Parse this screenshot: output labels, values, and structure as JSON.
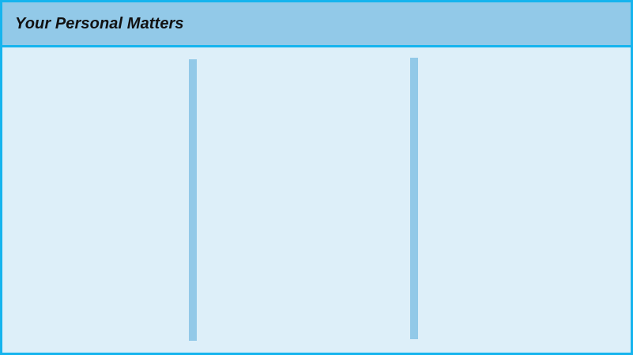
{
  "panel": {
    "title": "Your Personal Matters"
  },
  "colors": {
    "border": "#16b4ee",
    "header_background": "#92c9e8",
    "body_background": "#ddeff9",
    "divider": "#92c9e8",
    "title_text": "#111111"
  }
}
